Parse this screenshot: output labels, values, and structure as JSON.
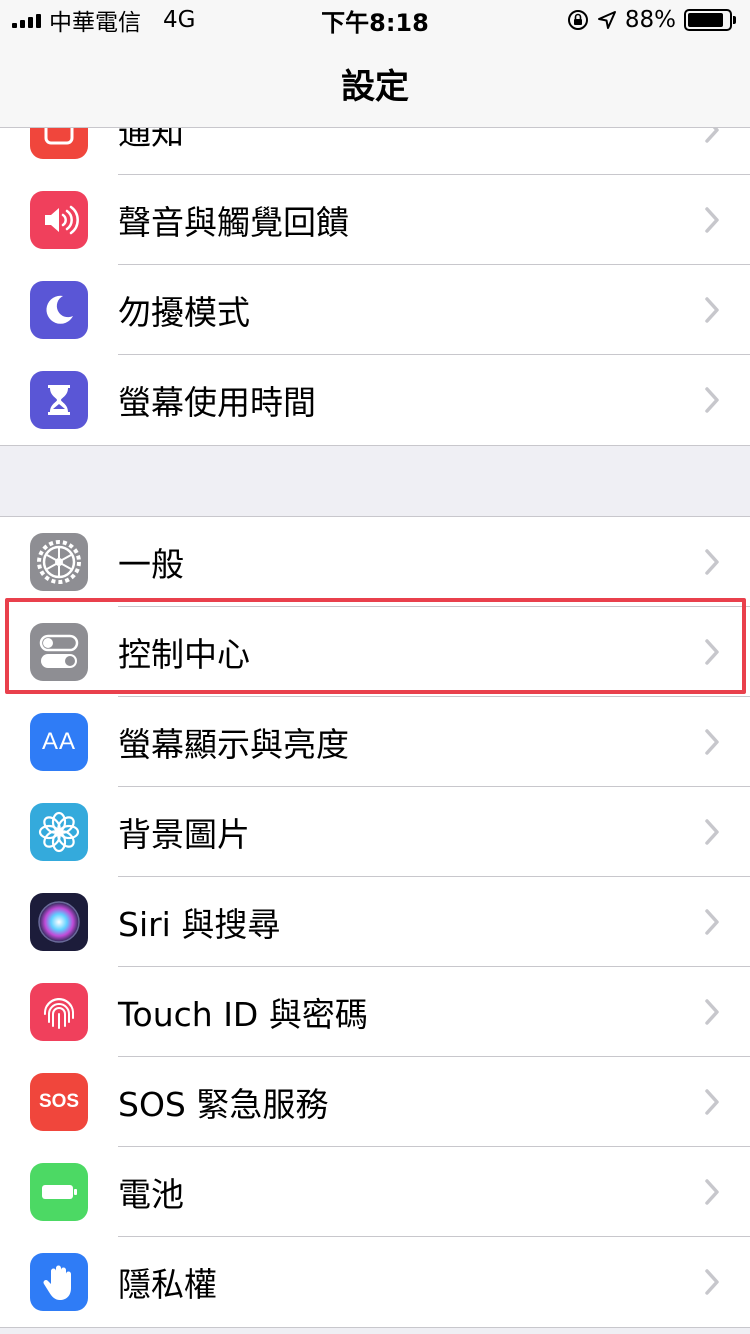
{
  "status_bar": {
    "carrier": "中華電信",
    "network": "4G",
    "time": "下午8:18",
    "battery": "88%",
    "battery_level": 0.88
  },
  "nav": {
    "title": "設定"
  },
  "group1": [
    {
      "label": "通知",
      "icon": "notifications-icon",
      "color": "#f0463c"
    },
    {
      "label": "聲音與觸覺回饋",
      "icon": "speaker-icon",
      "color": "#f0405c"
    },
    {
      "label": "勿擾模式",
      "icon": "moon-icon",
      "color": "#5a56d6"
    },
    {
      "label": "螢幕使用時間",
      "icon": "hourglass-icon",
      "color": "#5a56d6"
    }
  ],
  "group2": [
    {
      "label": "一般",
      "icon": "gear-icon",
      "color": "#8e8e93"
    },
    {
      "label": "控制中心",
      "icon": "switches-icon",
      "color": "#8e8e93"
    },
    {
      "label": "螢幕顯示與亮度",
      "icon": "text-size-icon",
      "color": "#2f7cf6",
      "glyph": "AA"
    },
    {
      "label": "背景圖片",
      "icon": "flower-icon",
      "color": "#34aadc"
    },
    {
      "label": "Siri 與搜尋",
      "icon": "siri-icon",
      "color": "#1c1c3a"
    },
    {
      "label": "Touch ID 與密碼",
      "icon": "fingerprint-icon",
      "color": "#f0405c"
    },
    {
      "label": "SOS 緊急服務",
      "icon": "sos-icon",
      "color": "#f0463c",
      "glyph": "SOS"
    },
    {
      "label": "電池",
      "icon": "battery-icon",
      "color": "#4cd964"
    },
    {
      "label": "隱私權",
      "icon": "hand-icon",
      "color": "#2f7cf6"
    }
  ],
  "colors": {
    "highlight": "#e9404c",
    "chevron": "#c7c7cc"
  }
}
